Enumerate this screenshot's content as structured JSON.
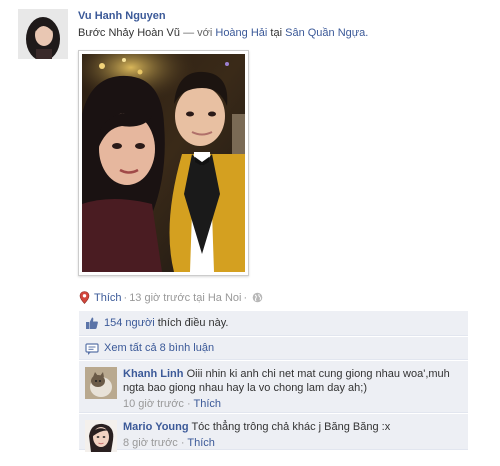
{
  "post": {
    "author": "Vu Hanh Nguyen",
    "status_prefix": "Bước Nhảy Hoàn Vũ",
    "dash": "—",
    "with_word": "với",
    "with_person": "Hoàng Hải",
    "at_word": "tại",
    "place": "Sân Quần Ngựa.",
    "like_link": "Thích",
    "dot": "·",
    "time_text": "13 giờ trước tại Ha Noi",
    "dot2": "·"
  },
  "feedback": {
    "likes_count": "154 người",
    "likes_suffix": "thích điều này.",
    "view_all": "Xem tất cả 8 bình luận"
  },
  "comments": [
    {
      "name": "Khanh Linh",
      "text": "Oiii nhin ki anh chi net mat cung giong nhau woa',muh ngta bao giong nhau hay la vo chong lam day ah;)",
      "time": "10 giờ trước",
      "sep": "·",
      "like": "Thích"
    },
    {
      "name": "Mario Young",
      "text": "Tóc thẳng trông chả khác j Băng Băng :x",
      "time": "8 giờ trước",
      "sep": "·",
      "like": "Thích"
    }
  ],
  "icons": {
    "location": "map-pin-icon",
    "privacy": "globe-icon",
    "like": "thumbs-up-icon",
    "comments": "comment-bubble-icon"
  },
  "colors": {
    "link": "#3b5998",
    "ufi_bg": "#edeff4",
    "meta": "#999999"
  }
}
